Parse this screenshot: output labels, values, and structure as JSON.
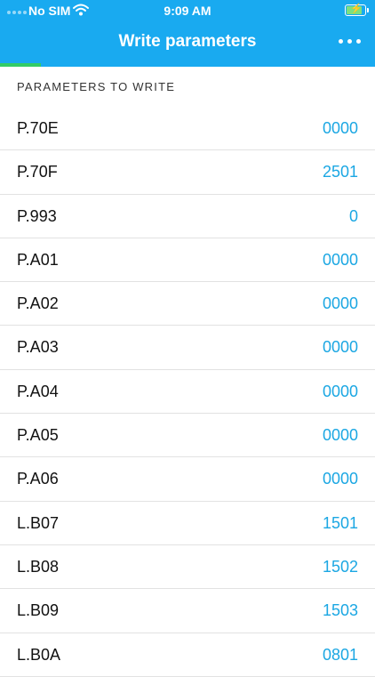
{
  "status_bar": {
    "carrier": "No SIM",
    "time": "9:09 AM",
    "wifi_icon": "wifi-icon",
    "battery_icon": "battery-charging-icon"
  },
  "nav": {
    "title": "Write parameters",
    "more_icon": "more-dots-icon"
  },
  "progress": {
    "fraction": 0.11
  },
  "section": {
    "header": "PARAMETERS TO WRITE"
  },
  "parameters": [
    {
      "name": "P.70E",
      "value": "0000"
    },
    {
      "name": "P.70F",
      "value": "2501"
    },
    {
      "name": "P.993",
      "value": "0"
    },
    {
      "name": "P.A01",
      "value": "0000"
    },
    {
      "name": "P.A02",
      "value": "0000"
    },
    {
      "name": "P.A03",
      "value": "0000"
    },
    {
      "name": "P.A04",
      "value": "0000"
    },
    {
      "name": "P.A05",
      "value": "0000"
    },
    {
      "name": "P.A06",
      "value": "0000"
    },
    {
      "name": "L.B07",
      "value": "1501"
    },
    {
      "name": "L.B08",
      "value": "1502"
    },
    {
      "name": "L.B09",
      "value": "1503"
    },
    {
      "name": "L.B0A",
      "value": "0801"
    }
  ],
  "colors": {
    "header_bg": "#19aaf0",
    "progress": "#33cc66",
    "value_text": "#1ba7e3"
  }
}
